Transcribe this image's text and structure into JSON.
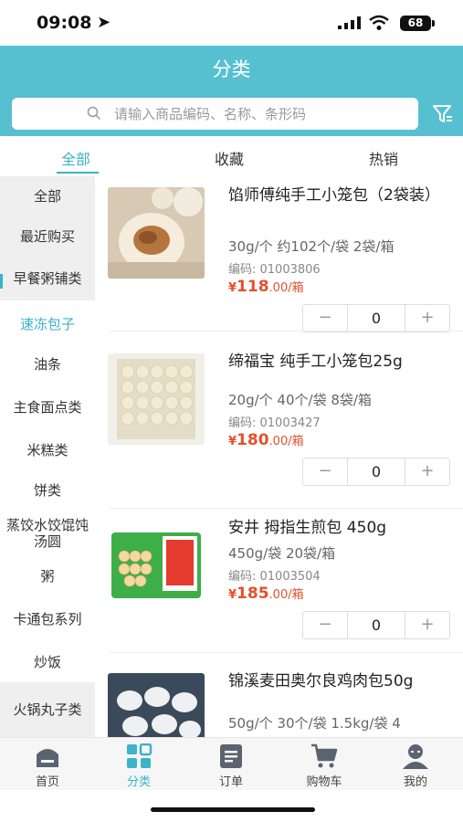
{
  "status": {
    "time": "09:08",
    "battery": "68"
  },
  "header": {
    "title": "分类"
  },
  "search": {
    "placeholder": "请输入商品编码、名称、条形码"
  },
  "tabs": [
    {
      "label": "全部"
    },
    {
      "label": "收藏"
    },
    {
      "label": "热销"
    }
  ],
  "sidebar": {
    "items": [
      {
        "label": "全部"
      },
      {
        "label": "最近购买"
      },
      {
        "label": "早餐粥铺类"
      },
      {
        "label": "速冻包子"
      },
      {
        "label": "油条"
      },
      {
        "label": "主食面点类"
      },
      {
        "label": "米糕类"
      },
      {
        "label": "饼类"
      },
      {
        "label": "蒸饺水饺馄饨汤圆"
      },
      {
        "label": "粥"
      },
      {
        "label": "卡通包系列"
      },
      {
        "label": "炒饭"
      },
      {
        "label": "火锅丸子类"
      }
    ]
  },
  "products": [
    {
      "name": "馅师傅纯手工小笼包（2袋装）",
      "spec": "30g/个 约102个/袋 2袋/箱",
      "code": "编码: 01003806",
      "currency": "¥",
      "price_int": "118",
      "price_dec": ".00",
      "unit": "/箱",
      "qty": "0"
    },
    {
      "name": "缔福宝 纯手工小笼包25g",
      "spec": "20g/个 40个/袋 8袋/箱",
      "code": "编码: 01003427",
      "currency": "¥",
      "price_int": "180",
      "price_dec": ".00",
      "unit": "/箱",
      "qty": "0"
    },
    {
      "name": "安井 拇指生煎包 450g",
      "spec": "450g/袋 20袋/箱",
      "code": "编码: 01003504",
      "currency": "¥",
      "price_int": "185",
      "price_dec": ".00",
      "unit": "/箱",
      "qty": "0"
    },
    {
      "name": "锦溪麦田奥尔良鸡肉包50g",
      "spec": "50g/个 30个/袋 1.5kg/袋 4",
      "code": "",
      "currency": "",
      "price_int": "",
      "price_dec": "",
      "unit": "",
      "qty": ""
    }
  ],
  "stepper": {
    "minus": "−",
    "plus": "+"
  },
  "bottom_nav": [
    {
      "label": "首页"
    },
    {
      "label": "分类"
    },
    {
      "label": "订单"
    },
    {
      "label": "购物车"
    },
    {
      "label": "我的"
    }
  ],
  "colors": {
    "accent": "#56c0d1",
    "accent_text": "#3bb3c8",
    "price": "#e5502d"
  }
}
